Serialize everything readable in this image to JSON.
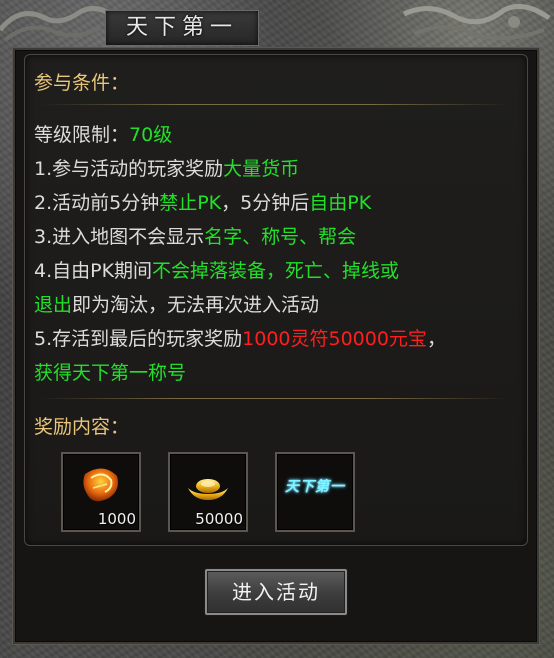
{
  "window": {
    "title": "天下第一"
  },
  "requirements": {
    "heading": "参与条件：",
    "level_label": "等级限制：",
    "level_value": "70级",
    "rule1_a": "1.参与活动的玩家奖励",
    "rule1_b": "大量货币",
    "rule2_a": "2.活动前5分钟",
    "rule2_b": "禁止PK",
    "rule2_c": "，5分钟后",
    "rule2_d": "自由PK",
    "rule3_a": "3.进入地图不会显示",
    "rule3_b": "名字、称号、帮会",
    "rule4_a": "4.自由PK期间",
    "rule4_b": "不会掉落装备，死亡、掉线或",
    "rule4_c": "退出",
    "rule4_d": "即为淘汰，无法再次进入活动",
    "rule5_a": "5.存活到最后的玩家奖励",
    "rule5_b": "1000灵符50000元宝",
    "rule5_c": "，",
    "rule5_d": "获得天下第一称号"
  },
  "rewards": {
    "heading": "奖励内容：",
    "items": [
      {
        "icon": "talisman-icon",
        "qty": "1000"
      },
      {
        "icon": "gold-ingot-icon",
        "qty": "50000"
      },
      {
        "icon": "title-badge-icon",
        "label": "天下第一"
      }
    ]
  },
  "actions": {
    "enter_label": "进入活动"
  },
  "colors": {
    "highlight_green": "#22e02a",
    "highlight_red": "#ff1e1e",
    "heading_gold": "#e9c67a"
  }
}
